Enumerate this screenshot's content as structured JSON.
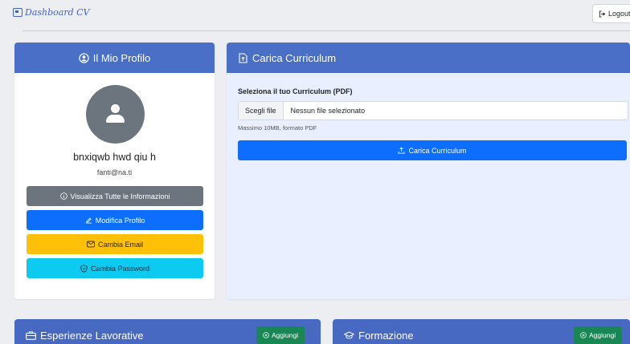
{
  "header": {
    "brand": "Dashboard CV",
    "logout_label": "Logout"
  },
  "profile": {
    "title": "Il Mio Profilo",
    "name": "bnxiqwb hwd qiu h",
    "email": "fanti@na.ti",
    "buttons": {
      "view_all": "Visualizza Tutte le Informazioni",
      "edit_profile": "Modifica Profilo",
      "change_email": "Cambia Email",
      "change_password": "Cambia Password"
    }
  },
  "upload": {
    "title": "Carica Curriculum",
    "label": "Seleziona il tuo Curriculum (PDF)",
    "choose_label": "Scegli file",
    "file_status": "Nessun file selezionato",
    "hint": "Massimo 10MB, formato PDF",
    "submit_label": "Carica Curriculum"
  },
  "experience": {
    "title": "Esperienze Lavorative",
    "add_label": "Aggiungi"
  },
  "education": {
    "title": "Formazione",
    "add_label": "Aggiungi"
  },
  "colors": {
    "card_header": "#4a6fc6",
    "primary": "#0d6efd",
    "secondary": "#6c757d",
    "warning": "#ffc107",
    "info": "#0dcaf0",
    "success": "#198754"
  }
}
